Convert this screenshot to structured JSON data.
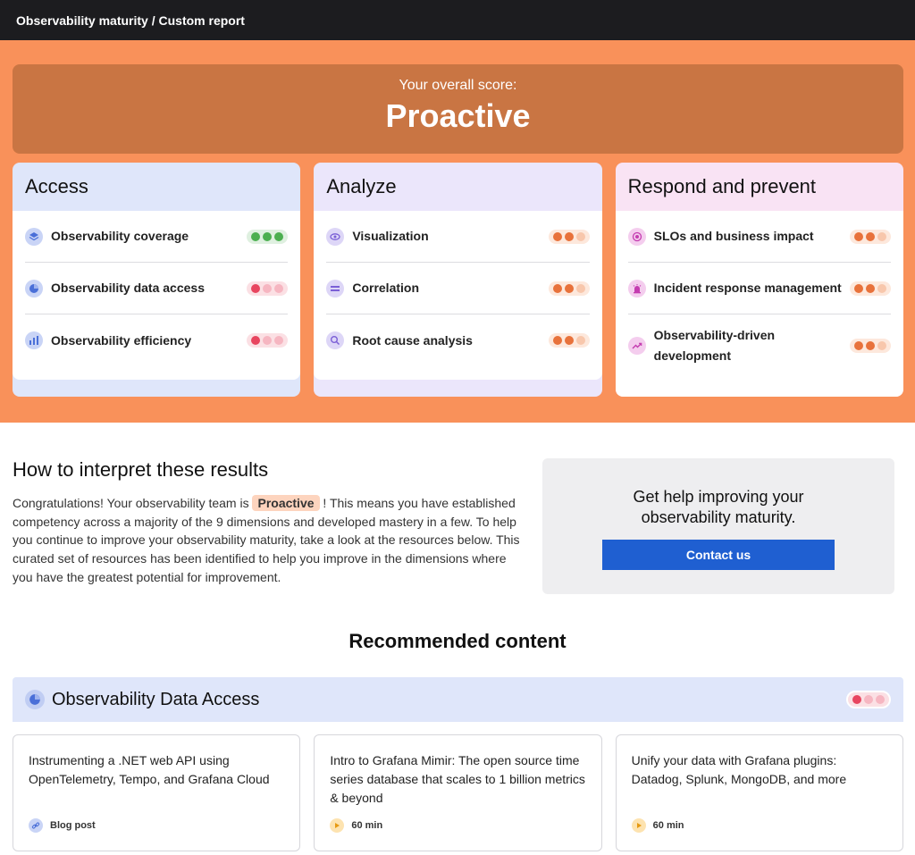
{
  "header": {
    "breadcrumb": "Observability maturity / Custom report"
  },
  "score": {
    "label": "Your overall score:",
    "value": "Proactive"
  },
  "categories": [
    {
      "title": "Access",
      "items": [
        {
          "label": "Observability coverage",
          "icon": "layers-icon",
          "rating": 3,
          "color": "green"
        },
        {
          "label": "Observability data access",
          "icon": "pie-chart-icon",
          "rating": 1,
          "color": "red"
        },
        {
          "label": "Observability efficiency",
          "icon": "bar-chart-icon",
          "rating": 1,
          "color": "red"
        }
      ]
    },
    {
      "title": "Analyze",
      "items": [
        {
          "label": "Visualization",
          "icon": "eye-icon",
          "rating": 2,
          "color": "orange"
        },
        {
          "label": "Correlation",
          "icon": "stack-icon",
          "rating": 2,
          "color": "orange"
        },
        {
          "label": "Root cause analysis",
          "icon": "search-icon",
          "rating": 2,
          "color": "orange"
        }
      ]
    },
    {
      "title": "Respond and prevent",
      "items": [
        {
          "label": "SLOs and business impact",
          "icon": "target-icon",
          "rating": 2,
          "color": "orange"
        },
        {
          "label": "Incident response management",
          "icon": "siren-icon",
          "rating": 2,
          "color": "orange"
        },
        {
          "label": "Observability-driven development",
          "icon": "trend-icon",
          "rating": 2,
          "color": "orange"
        }
      ]
    }
  ],
  "interpret": {
    "title": "How to interpret these results",
    "text_before": "Congratulations! Your observability team is ",
    "badge": "Proactive",
    "text_after": " ! This means you have established competency across a majority of the 9 dimensions and developed mastery in a few. To help you continue to improve your observability maturity, take a look at the resources below. This curated set of resources has been identified to help you improve in the dimensions where you have the greatest potential for improvement."
  },
  "help": {
    "title": "Get help improving your observability maturity.",
    "button": "Contact us"
  },
  "recommended": {
    "title": "Recommended content",
    "section_title": "Observability Data Access",
    "section_icon": "pie-chart-icon",
    "section_rating": 1,
    "cards": [
      {
        "title": "Instrumenting a .NET web API using OpenTelemetry, Tempo, and Grafana Cloud",
        "meta": "Blog post",
        "icon": "link-icon"
      },
      {
        "title": "Intro to Grafana Mimir: The open source time series database that scales to 1 billion metrics & beyond",
        "meta": "60 min",
        "icon": "play-icon"
      },
      {
        "title": "Unify your data with Grafana plugins: Datadog, Splunk, MongoDB, and more",
        "meta": "60 min",
        "icon": "play-icon"
      }
    ]
  },
  "colors": {
    "accent": "#f9915a",
    "score_bg": "#c97543",
    "button": "#1f5fd1"
  }
}
